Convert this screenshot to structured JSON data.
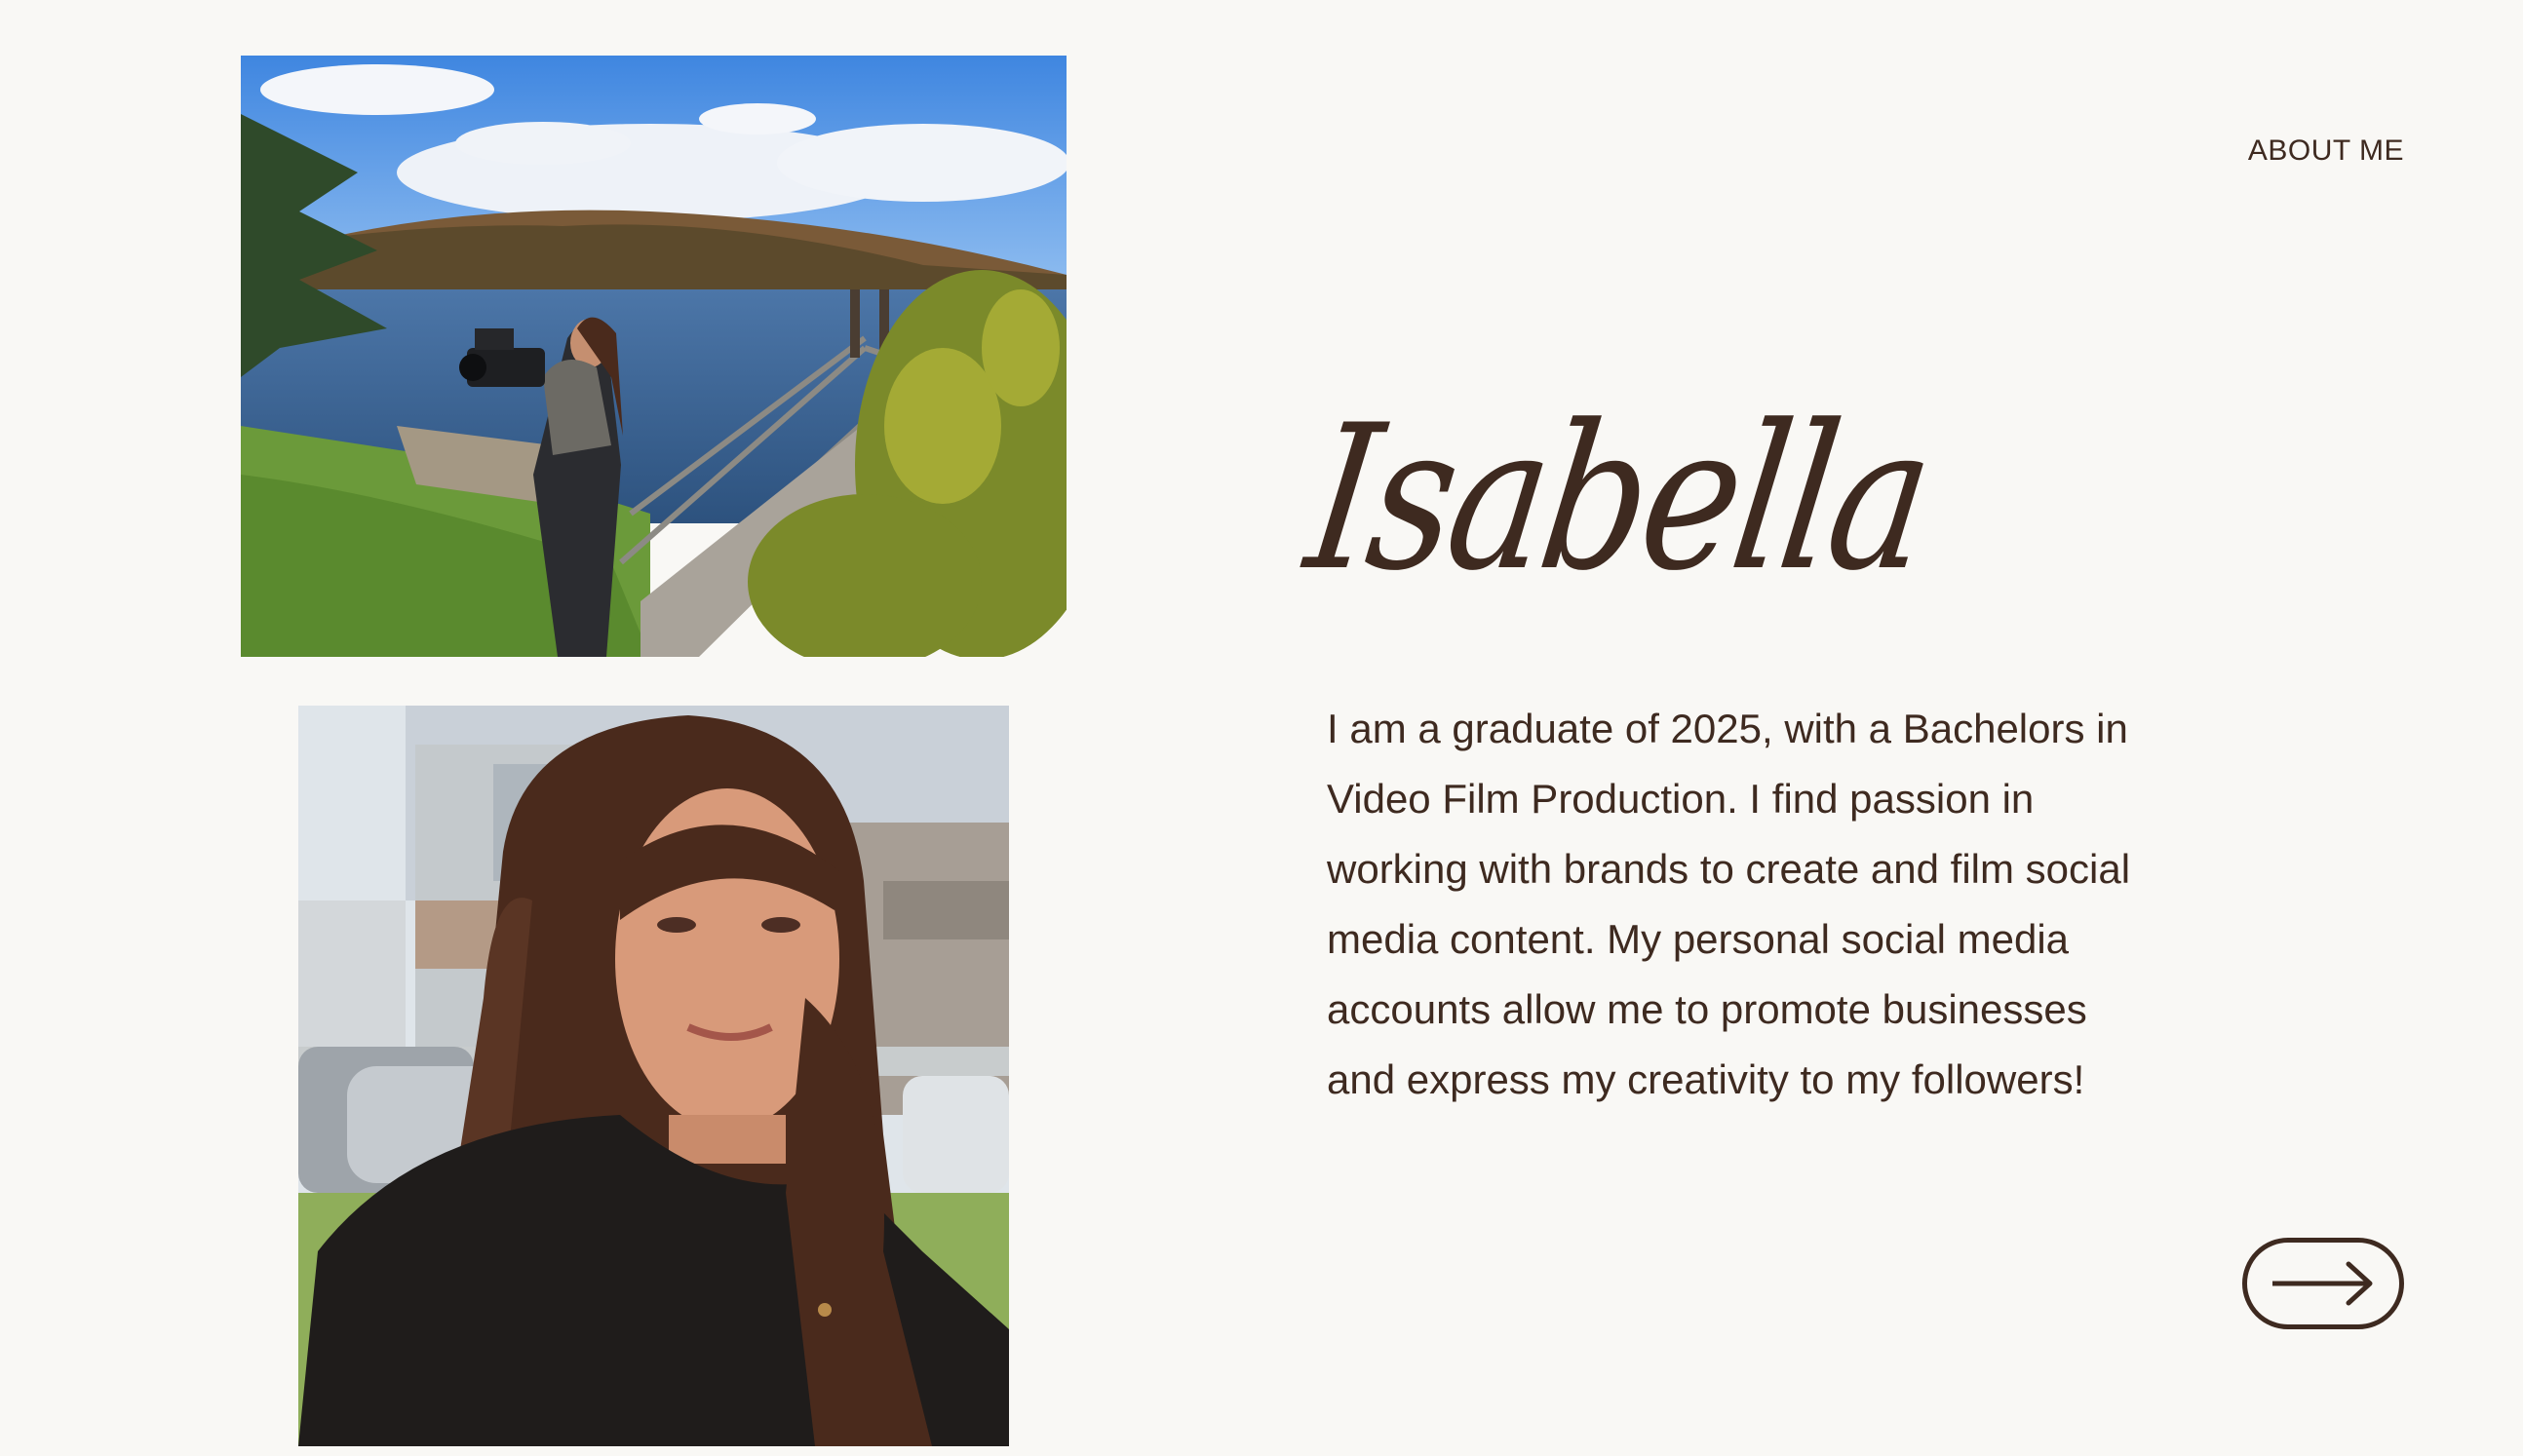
{
  "nav": {
    "about_label": "ABOUT ME"
  },
  "profile": {
    "name": "Isabella",
    "bio": "I am a graduate of 2025, with a Bachelors in Video Film Production. I find passion in working with brands to create and film social media content. My personal social media accounts allow me to promote businesses and express my creativity to my followers!"
  },
  "colors": {
    "background": "#f9f8f5",
    "text": "#3e2a20"
  },
  "icons": {
    "next": "arrow-right-icon"
  }
}
